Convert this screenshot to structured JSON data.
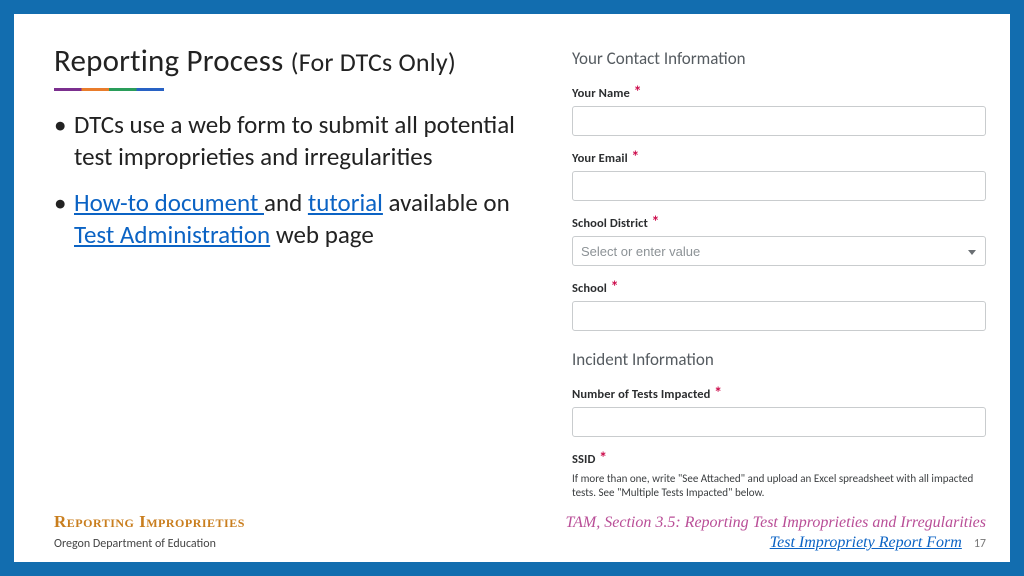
{
  "title_main": "Reporting Process ",
  "title_sub": "(For DTCs Only)",
  "bullets": {
    "b1": "DTCs use a web form to  submit all potential test improprieties and irregularities",
    "b2_pre": "",
    "b2_link1": "How-to document ",
    "b2_mid": "and ",
    "b2_link2": "tutorial",
    "b2_mid2": " available on ",
    "b2_link3": "Test Administration",
    "b2_end": " web page"
  },
  "form": {
    "section1": "Your Contact Information",
    "name_label": "Your Name",
    "email_label": "Your Email",
    "district_label": "School District",
    "district_placeholder": "Select or enter value",
    "school_label": "School",
    "section2": "Incident Information",
    "tests_label": "Number of Tests Impacted",
    "ssid_label": "SSID",
    "ssid_help": "If more than one, write \"See Attached\" and upload an Excel spreadsheet with all impacted tests. See \"Multiple Tests Impacted\" below.",
    "required_mark": "*"
  },
  "footer": {
    "section_label": "Reporting Improprieties",
    "tam": "TAM, Section 3.5: Reporting Test Improprieties and Irregularities",
    "org": "Oregon Department of Education",
    "form_link": "Test Impropriety Report Form",
    "page": "17"
  }
}
